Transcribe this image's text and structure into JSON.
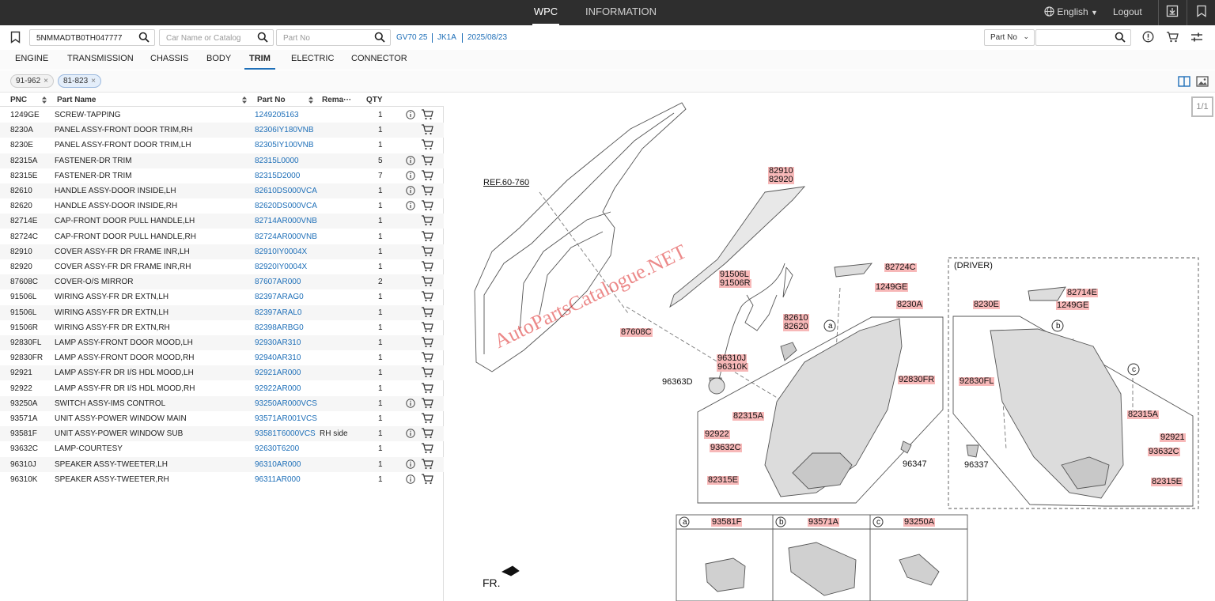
{
  "topbar": {
    "tabs": [
      "WPC",
      "INFORMATION"
    ],
    "language": "English",
    "logout": "Logout"
  },
  "search": {
    "vin": "5NMMADTB0TH047777",
    "car_placeholder": "Car Name or Catalog",
    "partno_placeholder": "Part No",
    "model": "GV70 25",
    "code": "JK1A",
    "date": "2025/08/23",
    "right_select": "Part No"
  },
  "categories": [
    "ENGINE",
    "TRANSMISSION",
    "CHASSIS",
    "BODY",
    "TRIM",
    "ELECTRIC",
    "CONNECTOR"
  ],
  "active_category": "TRIM",
  "chips": [
    {
      "label": "91-962",
      "close": "×"
    },
    {
      "label": "81-823",
      "close": "×"
    }
  ],
  "table": {
    "headers": {
      "pnc": "PNC",
      "name": "Part Name",
      "partno": "Part No",
      "remark": "Rema···",
      "qty": "QTY"
    },
    "rows": [
      {
        "pnc": "1249GE",
        "name": "SCREW-TAPPING",
        "partno": "1249205163",
        "remark": "",
        "qty": "1",
        "info": true
      },
      {
        "pnc": "8230A",
        "name": "PANEL ASSY-FRONT DOOR TRIM,RH",
        "partno": "82306IY180VNB",
        "remark": "",
        "qty": "1",
        "info": false
      },
      {
        "pnc": "8230E",
        "name": "PANEL ASSY-FRONT DOOR TRIM,LH",
        "partno": "82305IY100VNB",
        "remark": "",
        "qty": "1",
        "info": false
      },
      {
        "pnc": "82315A",
        "name": "FASTENER-DR TRIM",
        "partno": "82315L0000",
        "remark": "",
        "qty": "5",
        "info": true
      },
      {
        "pnc": "82315E",
        "name": "FASTENER-DR TRIM",
        "partno": "82315D2000",
        "remark": "",
        "qty": "7",
        "info": true
      },
      {
        "pnc": "82610",
        "name": "HANDLE ASSY-DOOR INSIDE,LH",
        "partno": "82610DS000VCA",
        "remark": "",
        "qty": "1",
        "info": true
      },
      {
        "pnc": "82620",
        "name": "HANDLE ASSY-DOOR INSIDE,RH",
        "partno": "82620DS000VCA",
        "remark": "",
        "qty": "1",
        "info": true
      },
      {
        "pnc": "82714E",
        "name": "CAP-FRONT DOOR PULL HANDLE,LH",
        "partno": "82714AR000VNB",
        "remark": "",
        "qty": "1",
        "info": false
      },
      {
        "pnc": "82724C",
        "name": "CAP-FRONT DOOR PULL HANDLE,RH",
        "partno": "82724AR000VNB",
        "remark": "",
        "qty": "1",
        "info": false
      },
      {
        "pnc": "82910",
        "name": "COVER ASSY-FR DR FRAME INR,LH",
        "partno": "82910IY0004X",
        "remark": "",
        "qty": "1",
        "info": false
      },
      {
        "pnc": "82920",
        "name": "COVER ASSY-FR DR FRAME INR,RH",
        "partno": "82920IY0004X",
        "remark": "",
        "qty": "1",
        "info": false
      },
      {
        "pnc": "87608C",
        "name": "COVER-O/S MIRROR",
        "partno": "87607AR000",
        "remark": "",
        "qty": "2",
        "info": false
      },
      {
        "pnc": "91506L",
        "name": "WIRING ASSY-FR DR EXTN,LH",
        "partno": "82397ARAG0",
        "remark": "",
        "qty": "1",
        "info": false
      },
      {
        "pnc": "91506L",
        "name": "WIRING ASSY-FR DR EXTN,LH",
        "partno": "82397ARAL0",
        "remark": "",
        "qty": "1",
        "info": false
      },
      {
        "pnc": "91506R",
        "name": "WIRING ASSY-FR DR EXTN,RH",
        "partno": "82398ARBG0",
        "remark": "",
        "qty": "1",
        "info": false
      },
      {
        "pnc": "92830FL",
        "name": "LAMP ASSY-FRONT DOOR MOOD,LH",
        "partno": "92930AR310",
        "remark": "",
        "qty": "1",
        "info": false
      },
      {
        "pnc": "92830FR",
        "name": "LAMP ASSY-FRONT DOOR MOOD,RH",
        "partno": "92940AR310",
        "remark": "",
        "qty": "1",
        "info": false
      },
      {
        "pnc": "92921",
        "name": "LAMP ASSY-FR DR I/S HDL MOOD,LH",
        "partno": "92921AR000",
        "remark": "",
        "qty": "1",
        "info": false
      },
      {
        "pnc": "92922",
        "name": "LAMP ASSY-FR DR I/S HDL MOOD,RH",
        "partno": "92922AR000",
        "remark": "",
        "qty": "1",
        "info": false
      },
      {
        "pnc": "93250A",
        "name": "SWITCH ASSY-IMS CONTROL",
        "partno": "93250AR000VCS",
        "remark": "",
        "qty": "1",
        "info": true
      },
      {
        "pnc": "93571A",
        "name": "UNIT ASSY-POWER WINDOW MAIN",
        "partno": "93571AR001VCS",
        "remark": "",
        "qty": "1",
        "info": false
      },
      {
        "pnc": "93581F",
        "name": "UNIT ASSY-POWER WINDOW SUB",
        "partno": "93581T6000VCS",
        "remark": "RH side",
        "qty": "1",
        "info": true
      },
      {
        "pnc": "93632C",
        "name": "LAMP-COURTESY",
        "partno": "92630T6200",
        "remark": "",
        "qty": "1",
        "info": false
      },
      {
        "pnc": "96310J",
        "name": "SPEAKER ASSY-TWEETER,LH",
        "partno": "96310AR000",
        "remark": "",
        "qty": "1",
        "info": true
      },
      {
        "pnc": "96310K",
        "name": "SPEAKER ASSY-TWEETER,RH",
        "partno": "96311AR000",
        "remark": "",
        "qty": "1",
        "info": true
      }
    ]
  },
  "diagram": {
    "pager": "1/1",
    "ref": "REF.60-760",
    "fr": "FR.",
    "driver": "(DRIVER)",
    "watermark": "AutoPartsCatalogue.NET",
    "callouts": {
      "a": "a",
      "b": "b",
      "c": "c",
      "l82910": "82910",
      "l82920": "82920",
      "l82724C": "82724C",
      "l1249GE_1": "1249GE",
      "l8230A": "8230A",
      "l91506L": "91506L",
      "l91506R": "91506R",
      "l82610": "82610",
      "l82620": "82620",
      "l87608C": "87608C",
      "l96310J": "96310J",
      "l96310K": "96310K",
      "l96363D": "96363D",
      "l92830FR": "92830FR",
      "l82315A_1": "82315A",
      "l92922": "92922",
      "l93632C_1": "93632C",
      "l82315E_1": "82315E",
      "l96347": "96347",
      "l8230E": "8230E",
      "l82714E": "82714E",
      "l1249GE_2": "1249GE",
      "l92830FL": "92830FL",
      "l82315A_2": "82315A",
      "l92921": "92921",
      "l93632C_2": "93632C",
      "l82315E_2": "82315E",
      "l96337": "96337",
      "l93581F": "93581F",
      "l93571A": "93571A",
      "l93250A": "93250A"
    }
  }
}
